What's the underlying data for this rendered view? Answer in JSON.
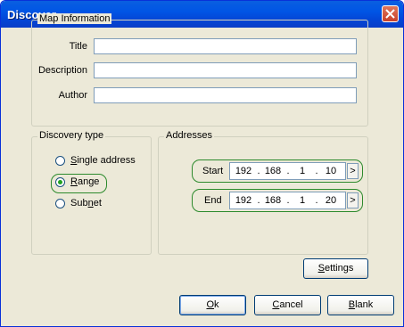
{
  "window": {
    "title": "Discover"
  },
  "map_info": {
    "legend": "Map Information",
    "title_label": "Title",
    "description_label": "Description",
    "author_label": "Author",
    "title_value": "",
    "description_value": "",
    "author_value": ""
  },
  "discovery": {
    "legend": "Discovery type",
    "options": [
      {
        "pre": "",
        "key": "S",
        "post": "ingle address",
        "selected": false
      },
      {
        "pre": "",
        "key": "R",
        "post": "ange",
        "selected": true
      },
      {
        "pre": "Sub",
        "key": "n",
        "post": "et",
        "selected": false
      }
    ]
  },
  "addresses": {
    "legend": "Addresses",
    "start_label": "Start",
    "end_label": "End",
    "start": [
      "192",
      "168",
      "1",
      "10"
    ],
    "end": [
      "192",
      "168",
      "1",
      "20"
    ],
    "arrow": ">"
  },
  "buttons": {
    "settings_pre": "",
    "settings_key": "S",
    "settings_post": "ettings",
    "ok_pre": "",
    "ok_key": "O",
    "ok_post": "k",
    "cancel_pre": "",
    "cancel_key": "C",
    "cancel_post": "ancel",
    "blank_pre": "",
    "blank_key": "B",
    "blank_post": "lank"
  },
  "colors": {
    "titlebar": "#0055e5",
    "highlight": "#2c8a2c",
    "dialog_bg": "#ece9d8"
  }
}
